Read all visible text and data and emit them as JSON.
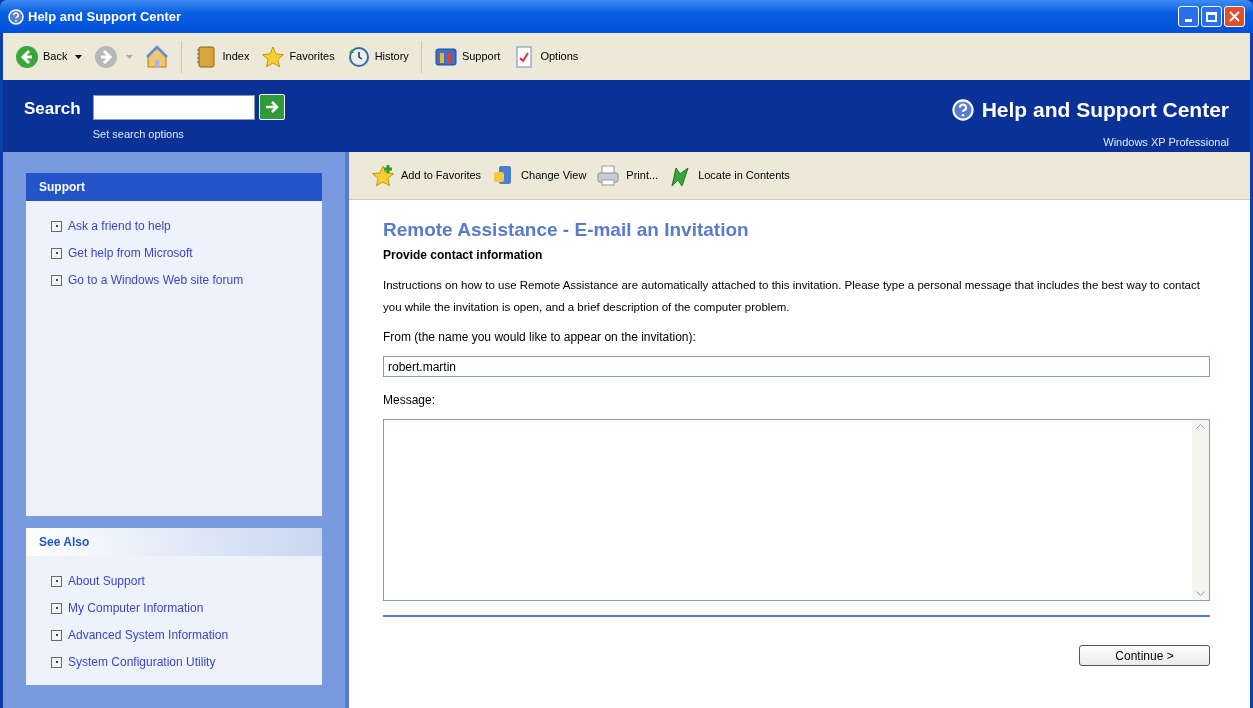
{
  "window": {
    "title": "Help and Support Center"
  },
  "toolbar": [
    {
      "kind": "back",
      "label": "Back",
      "disabled": false
    },
    {
      "kind": "forward",
      "disabled": true
    },
    {
      "kind": "home"
    },
    {
      "kind": "index",
      "label": "Index"
    },
    {
      "kind": "favorites",
      "label": "Favorites"
    },
    {
      "kind": "history",
      "label": "History"
    },
    {
      "kind": "support",
      "label": "Support"
    },
    {
      "kind": "options",
      "label": "Options"
    }
  ],
  "search": {
    "label": "Search",
    "options_link": "Set search options"
  },
  "brand": {
    "title": "Help and Support Center",
    "subtitle": "Windows XP Professional"
  },
  "sidebar": {
    "sections": [
      {
        "title": "Support",
        "items": [
          "Ask a friend to help",
          "Get help from Microsoft",
          "Go to a Windows Web site forum"
        ]
      },
      {
        "title": "See Also",
        "items": [
          "About Support",
          "My Computer Information",
          "Advanced System Information",
          "System Configuration Utility"
        ]
      }
    ]
  },
  "content_toolbar": [
    {
      "kind": "add-favorites",
      "label": "Add to Favorites"
    },
    {
      "kind": "change-view",
      "label": "Change View"
    },
    {
      "kind": "print",
      "label": "Print..."
    },
    {
      "kind": "locate",
      "label": "Locate in Contents"
    }
  ],
  "page": {
    "title": "Remote Assistance - E-mail an Invitation",
    "subtitle": "Provide contact information",
    "instructions": "Instructions on how to use Remote Assistance are automatically attached to this invitation. Please type a personal message that includes the best way to contact you while the invitation is open, and a brief description of the computer problem.",
    "from_label": "From (the name you would like to appear on the invitation):",
    "from_value": "robert.martin",
    "message_label": "Message:",
    "continue_button": "Continue >"
  }
}
